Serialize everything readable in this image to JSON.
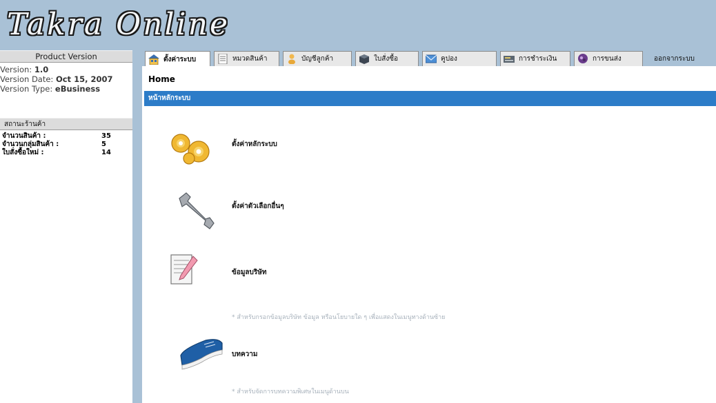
{
  "app": {
    "logo_text": "Takra Online"
  },
  "sidebar": {
    "version_header": "Product Version",
    "version": {
      "label": "Version:",
      "value": "1.0"
    },
    "version_date": {
      "label": "Version Date:",
      "value": "Oct 15, 2007"
    },
    "version_type": {
      "label": "Version Type:",
      "value": "eBusiness"
    },
    "store_header": "สถานะร้านค้า",
    "stats": [
      {
        "label": "จำนวนสินค้า :",
        "value": "35"
      },
      {
        "label": "จำนวนกลุ่มสินค้า :",
        "value": "5"
      },
      {
        "label": "ใบสั่งซื้อใหม่ :",
        "value": "14"
      }
    ]
  },
  "tabs": [
    {
      "label": "ตั้งค่าระบบ",
      "icon": "home-icon",
      "active": true
    },
    {
      "label": "หมวดสินค้า",
      "icon": "document-list-icon",
      "active": false
    },
    {
      "label": "บัญชีลูกค้า",
      "icon": "user-icon",
      "active": false
    },
    {
      "label": "ใบสั่งซื้อ",
      "icon": "box-icon",
      "active": false
    },
    {
      "label": "คูปอง",
      "icon": "envelope-icon",
      "active": false
    },
    {
      "label": "การชำระเงิน",
      "icon": "credit-card-icon",
      "active": false
    },
    {
      "label": "การขนส่ง",
      "icon": "truck-icon",
      "active": false
    }
  ],
  "logout_label": "ออกจากระบบ",
  "content": {
    "breadcrumb": "Home",
    "section_title": "หน้าหลักระบบ",
    "items": [
      {
        "label": "ตั้งค่าหลักระบบ",
        "icon": "gears-icon",
        "note": ""
      },
      {
        "label": "ตั้งค่าตัวเลือกอื่นๆ",
        "icon": "wrench-icon",
        "note": ""
      },
      {
        "label": "ข้อมูลบริษัท",
        "icon": "document-pencil-icon",
        "note": "* สำหรับกรอกข้อมูลบริษัท ข้อมูล หรือนโยบายใด ๆ เพื่อแสดงในเมนูทางด้านซ้าย"
      },
      {
        "label": "บทความ",
        "icon": "book-icon",
        "note": "* สำหรับจัดการบทความพิเศษในเมนูด้านบน"
      }
    ]
  },
  "colors": {
    "background": "#a9c1d6",
    "section_bar": "#2c7cc8",
    "panel_header": "#dcdcdc"
  }
}
